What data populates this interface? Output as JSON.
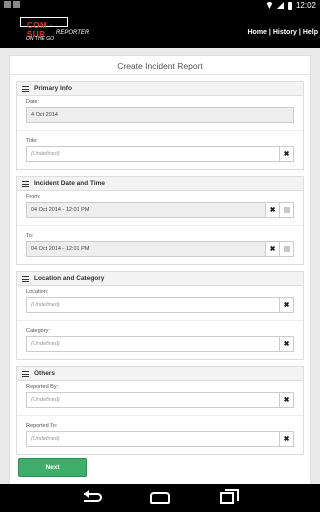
{
  "status_bar": {
    "time": "12:02"
  },
  "app": {
    "logo_text": "COM · SUR",
    "logo_sub1": "REPORTER",
    "logo_sub2": "ON THE GO",
    "nav": {
      "home": "Home",
      "history": "History",
      "help": "Help",
      "sep": "|"
    }
  },
  "form": {
    "title": "Create Incident Report",
    "sections": [
      {
        "header": "Primary Info",
        "fields": [
          {
            "label": "Date:",
            "value": "4 Oct 2014"
          },
          {
            "label": "Title:",
            "placeholder": "(Undefined)"
          }
        ]
      },
      {
        "header": "Incident Date and Time",
        "fields": [
          {
            "label": "From:",
            "value": "04 Oct 2014 - 12:01 PM"
          },
          {
            "label": "To:",
            "value": "04 Oct 2014 - 12:01 PM"
          }
        ]
      },
      {
        "header": "Location and Category",
        "fields": [
          {
            "label": "Location:",
            "placeholder": "(Undefined)"
          },
          {
            "label": "Category:",
            "placeholder": "(Undefined)"
          }
        ]
      },
      {
        "header": "Others",
        "fields": [
          {
            "label": "Reported By:",
            "placeholder": "(Undefined)"
          },
          {
            "label": "Reported To:",
            "placeholder": "(Undefined)"
          }
        ]
      }
    ],
    "clear_icon_glyph": "✖",
    "next_label": "Next"
  },
  "colors": {
    "accent": "#3fae6a",
    "brand": "#e63027"
  }
}
